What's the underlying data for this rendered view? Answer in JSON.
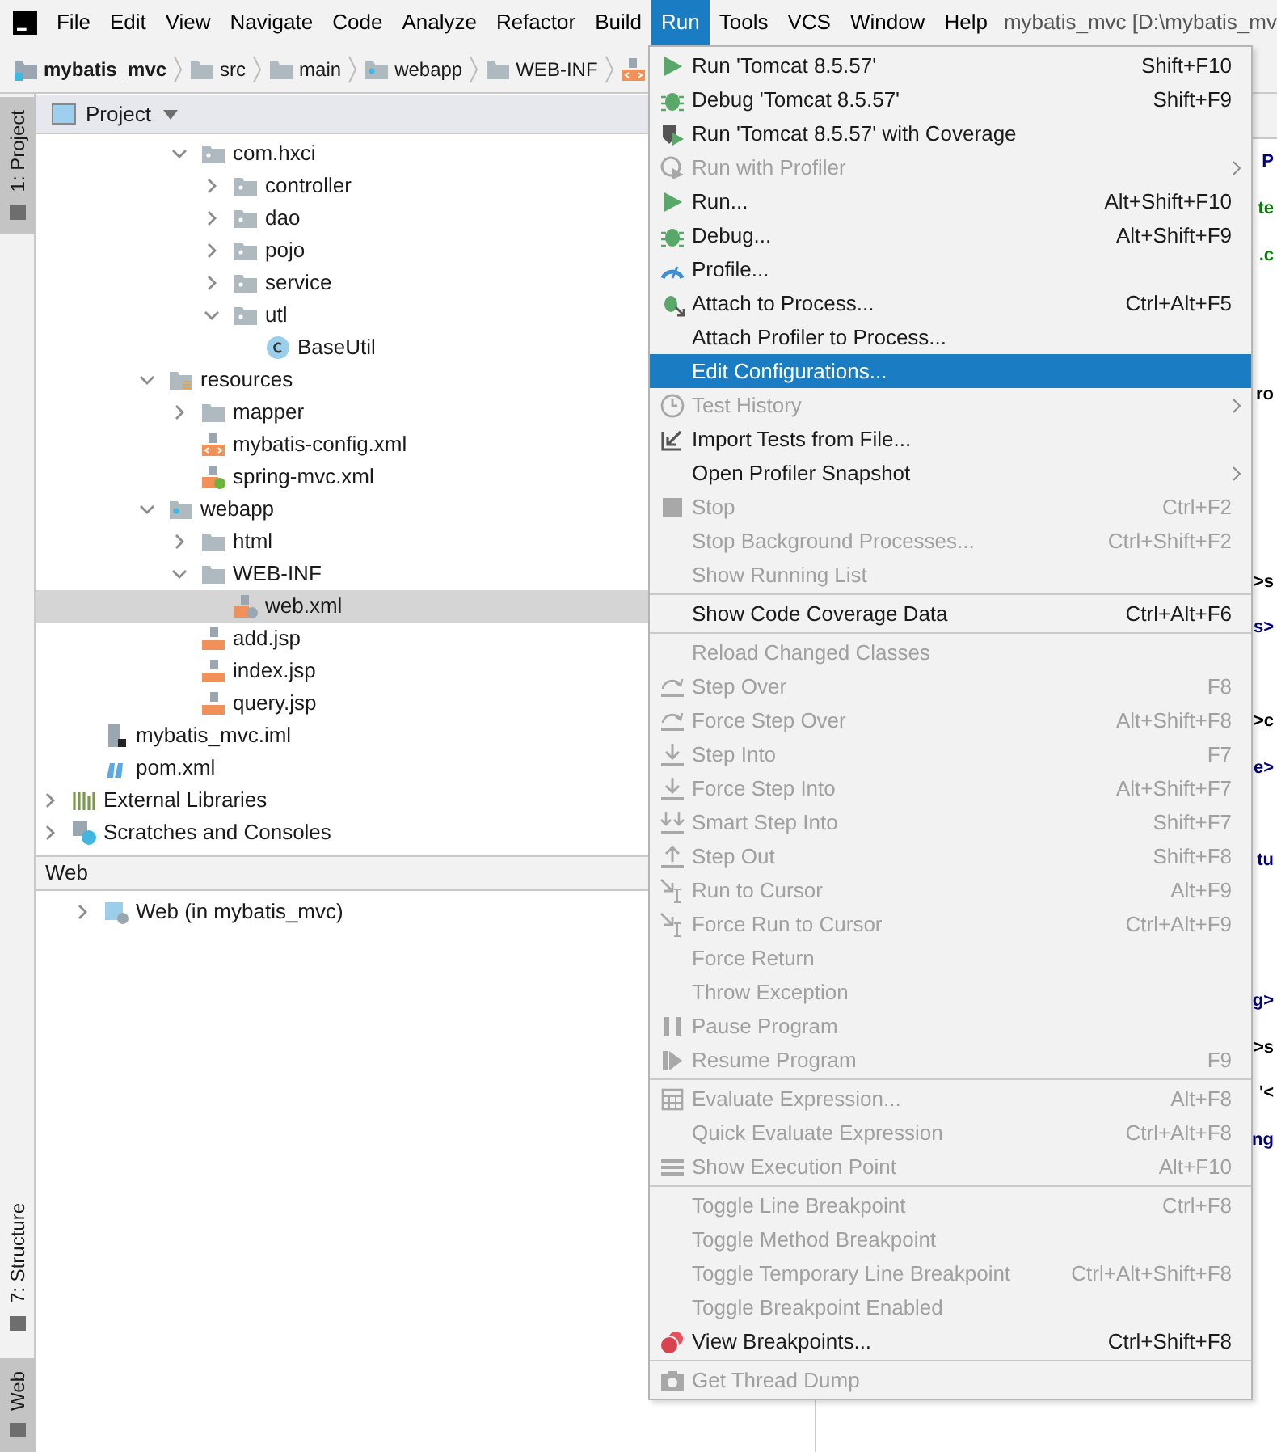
{
  "menu_bar": {
    "items": [
      {
        "label": "File",
        "selected": false
      },
      {
        "label": "Edit",
        "selected": false
      },
      {
        "label": "View",
        "selected": false
      },
      {
        "label": "Navigate",
        "selected": false
      },
      {
        "label": "Code",
        "selected": false
      },
      {
        "label": "Analyze",
        "selected": false
      },
      {
        "label": "Refactor",
        "selected": false
      },
      {
        "label": "Build",
        "selected": false
      },
      {
        "label": "Run",
        "selected": true
      },
      {
        "label": "Tools",
        "selected": false
      },
      {
        "label": "VCS",
        "selected": false
      },
      {
        "label": "Window",
        "selected": false
      },
      {
        "label": "Help",
        "selected": false
      }
    ],
    "title": "mybatis_mvc [D:\\mybatis_mv"
  },
  "breadcrumbs": [
    {
      "label": "mybatis_mvc",
      "kind": "project"
    },
    {
      "label": "src",
      "kind": "folder"
    },
    {
      "label": "main",
      "kind": "folder"
    },
    {
      "label": "webapp",
      "kind": "web"
    },
    {
      "label": "WEB-INF",
      "kind": "folder"
    }
  ],
  "side_tabs": [
    {
      "label": "1: Project",
      "selected": true
    },
    {
      "label": "7: Structure",
      "selected": false
    },
    {
      "label": "Web",
      "selected": true
    }
  ],
  "project_panel": {
    "title": "Project",
    "tree": [
      {
        "children": [
          {
            "children": [
              {
                "children": [
                  {
                    "children": [
                      {
                        "label": "com.hxci",
                        "kind": "package",
                        "expanded": true,
                        "selected": false,
                        "children": [
                          {
                            "label": "controller",
                            "kind": "package",
                            "expanded": false,
                            "selected": false
                          },
                          {
                            "label": "dao",
                            "kind": "package",
                            "expanded": false,
                            "selected": false
                          },
                          {
                            "label": "pojo",
                            "kind": "package",
                            "expanded": false,
                            "selected": false
                          },
                          {
                            "label": "service",
                            "kind": "package",
                            "expanded": false,
                            "selected": false
                          },
                          {
                            "label": "utl",
                            "kind": "package",
                            "expanded": true,
                            "selected": false,
                            "children": [
                              {
                                "label": "BaseUtil",
                                "kind": "class",
                                "selected": false
                              }
                            ]
                          }
                        ]
                      }
                    ]
                  },
                  {
                    "label": "resources",
                    "kind": "resources",
                    "expanded": true,
                    "selected": false,
                    "children": [
                      {
                        "label": "mapper",
                        "kind": "folder",
                        "expanded": false,
                        "selected": false
                      },
                      {
                        "label": "mybatis-config.xml",
                        "kind": "xml",
                        "selected": false
                      },
                      {
                        "label": "spring-mvc.xml",
                        "kind": "spring-xml",
                        "selected": false
                      }
                    ]
                  },
                  {
                    "label": "webapp",
                    "kind": "web",
                    "expanded": true,
                    "selected": false,
                    "children": [
                      {
                        "label": "html",
                        "kind": "folder",
                        "expanded": false,
                        "selected": false
                      },
                      {
                        "label": "WEB-INF",
                        "kind": "folder",
                        "expanded": true,
                        "selected": false,
                        "children": [
                          {
                            "label": "web.xml",
                            "kind": "web-xml",
                            "selected": true
                          }
                        ]
                      },
                      {
                        "label": "add.jsp",
                        "kind": "jsp",
                        "selected": false
                      },
                      {
                        "label": "index.jsp",
                        "kind": "jsp",
                        "selected": false
                      },
                      {
                        "label": "query.jsp",
                        "kind": "jsp",
                        "selected": false
                      }
                    ]
                  }
                ]
              }
            ]
          },
          {
            "label": "mybatis_mvc.iml",
            "kind": "iml",
            "selected": false
          },
          {
            "label": "pom.xml",
            "kind": "pom",
            "selected": false
          }
        ]
      },
      {
        "label": "External Libraries",
        "kind": "libraries",
        "expanded": false,
        "selected": false
      },
      {
        "label": "Scratches and Consoles",
        "kind": "scratches",
        "expanded": false,
        "selected": false
      }
    ]
  },
  "web_panel": {
    "title": "Web",
    "tree": [
      {
        "label": "Web (in mybatis_mvc)",
        "kind": "web-facet",
        "expanded": false,
        "selected": false
      }
    ]
  },
  "editor_fragments": [
    {
      "text": "P",
      "color": "#000080"
    },
    {
      "text": "te",
      "color": "#008000"
    },
    {
      "text": ".c",
      "color": "#008000"
    },
    {
      "text": "ro",
      "color": "#000000"
    },
    {
      "text": ">s",
      "color": "#000000"
    },
    {
      "text": "s>",
      "color": "#000080"
    },
    {
      "text": ">c",
      "color": "#000000"
    },
    {
      "text": "e>",
      "color": "#000080"
    },
    {
      "text": "tu",
      "color": "#000080"
    },
    {
      "text": "g>",
      "color": "#000080"
    },
    {
      "text": ">s",
      "color": "#000000"
    },
    {
      "text": "'<",
      "color": "#000000"
    },
    {
      "text": "ng",
      "color": "#000080"
    }
  ],
  "run_menu": [
    {
      "kind": "item",
      "label": "Run 'Tomcat 8.5.57'",
      "shortcut": "Shift+F10",
      "disabled": false,
      "submenu": false,
      "selected": false
    },
    {
      "kind": "item",
      "label": "Debug 'Tomcat 8.5.57'",
      "shortcut": "Shift+F9",
      "disabled": false,
      "submenu": false,
      "selected": false
    },
    {
      "kind": "item",
      "label": "Run 'Tomcat 8.5.57' with Coverage",
      "disabled": false,
      "submenu": false,
      "selected": false
    },
    {
      "kind": "item",
      "label": "Run with Profiler",
      "disabled": true,
      "submenu": true,
      "selected": false
    },
    {
      "kind": "item",
      "label": "Run...",
      "shortcut": "Alt+Shift+F10",
      "disabled": false,
      "submenu": false,
      "selected": false
    },
    {
      "kind": "item",
      "label": "Debug...",
      "shortcut": "Alt+Shift+F9",
      "disabled": false,
      "submenu": false,
      "selected": false
    },
    {
      "kind": "item",
      "label": "Profile...",
      "disabled": false,
      "submenu": false,
      "selected": false
    },
    {
      "kind": "item",
      "label": "Attach to Process...",
      "shortcut": "Ctrl+Alt+F5",
      "disabled": false,
      "submenu": false,
      "selected": false
    },
    {
      "kind": "item",
      "label": "Attach Profiler to Process...",
      "disabled": false,
      "submenu": false,
      "selected": false
    },
    {
      "kind": "item",
      "label": "Edit Configurations...",
      "disabled": false,
      "submenu": false,
      "selected": true
    },
    {
      "kind": "item",
      "label": "Test History",
      "disabled": true,
      "submenu": true,
      "selected": false
    },
    {
      "kind": "item",
      "label": "Import Tests from File...",
      "disabled": false,
      "submenu": false,
      "selected": false
    },
    {
      "kind": "item",
      "label": "Open Profiler Snapshot",
      "disabled": false,
      "submenu": true,
      "selected": false
    },
    {
      "kind": "item",
      "label": "Stop",
      "shortcut": "Ctrl+F2",
      "disabled": true,
      "submenu": false,
      "selected": false
    },
    {
      "kind": "item",
      "label": "Stop Background Processes...",
      "shortcut": "Ctrl+Shift+F2",
      "disabled": true,
      "submenu": false,
      "selected": false
    },
    {
      "kind": "item",
      "label": "Show Running List",
      "disabled": true,
      "submenu": false,
      "selected": false
    },
    {
      "kind": "separator"
    },
    {
      "kind": "item",
      "label": "Show Code Coverage Data",
      "shortcut": "Ctrl+Alt+F6",
      "disabled": false,
      "submenu": false,
      "selected": false
    },
    {
      "kind": "separator"
    },
    {
      "kind": "item",
      "label": "Reload Changed Classes",
      "disabled": true,
      "submenu": false,
      "selected": false
    },
    {
      "kind": "item",
      "label": "Step Over",
      "shortcut": "F8",
      "disabled": true,
      "submenu": false,
      "selected": false
    },
    {
      "kind": "item",
      "label": "Force Step Over",
      "shortcut": "Alt+Shift+F8",
      "disabled": true,
      "submenu": false,
      "selected": false
    },
    {
      "kind": "item",
      "label": "Step Into",
      "shortcut": "F7",
      "disabled": true,
      "submenu": false,
      "selected": false
    },
    {
      "kind": "item",
      "label": "Force Step Into",
      "shortcut": "Alt+Shift+F7",
      "disabled": true,
      "submenu": false,
      "selected": false
    },
    {
      "kind": "item",
      "label": "Smart Step Into",
      "shortcut": "Shift+F7",
      "disabled": true,
      "submenu": false,
      "selected": false
    },
    {
      "kind": "item",
      "label": "Step Out",
      "shortcut": "Shift+F8",
      "disabled": true,
      "submenu": false,
      "selected": false
    },
    {
      "kind": "item",
      "label": "Run to Cursor",
      "shortcut": "Alt+F9",
      "disabled": true,
      "submenu": false,
      "selected": false
    },
    {
      "kind": "item",
      "label": "Force Run to Cursor",
      "shortcut": "Ctrl+Alt+F9",
      "disabled": true,
      "submenu": false,
      "selected": false
    },
    {
      "kind": "item",
      "label": "Force Return",
      "disabled": true,
      "submenu": false,
      "selected": false
    },
    {
      "kind": "item",
      "label": "Throw Exception",
      "disabled": true,
      "submenu": false,
      "selected": false
    },
    {
      "kind": "item",
      "label": "Pause Program",
      "disabled": true,
      "submenu": false,
      "selected": false
    },
    {
      "kind": "item",
      "label": "Resume Program",
      "shortcut": "F9",
      "disabled": true,
      "submenu": false,
      "selected": false
    },
    {
      "kind": "separator"
    },
    {
      "kind": "item",
      "label": "Evaluate Expression...",
      "shortcut": "Alt+F8",
      "disabled": true,
      "submenu": false,
      "selected": false
    },
    {
      "kind": "item",
      "label": "Quick Evaluate Expression",
      "shortcut": "Ctrl+Alt+F8",
      "disabled": true,
      "submenu": false,
      "selected": false
    },
    {
      "kind": "item",
      "label": "Show Execution Point",
      "shortcut": "Alt+F10",
      "disabled": true,
      "submenu": false,
      "selected": false
    },
    {
      "kind": "separator"
    },
    {
      "kind": "item",
      "label": "Toggle Line Breakpoint",
      "shortcut": "Ctrl+F8",
      "disabled": true,
      "submenu": false,
      "selected": false
    },
    {
      "kind": "item",
      "label": "Toggle Method Breakpoint",
      "disabled": true,
      "submenu": false,
      "selected": false
    },
    {
      "kind": "item",
      "label": "Toggle Temporary Line Breakpoint",
      "shortcut": "Ctrl+Alt+Shift+F8",
      "disabled": true,
      "submenu": false,
      "selected": false
    },
    {
      "kind": "item",
      "label": "Toggle Breakpoint Enabled",
      "disabled": true,
      "submenu": false,
      "selected": false
    },
    {
      "kind": "item",
      "label": "View Breakpoints...",
      "shortcut": "Ctrl+Shift+F8",
      "disabled": false,
      "submenu": false,
      "selected": false
    },
    {
      "kind": "separator"
    },
    {
      "kind": "item",
      "label": "Get Thread Dump",
      "disabled": true,
      "submenu": false,
      "selected": false
    }
  ]
}
